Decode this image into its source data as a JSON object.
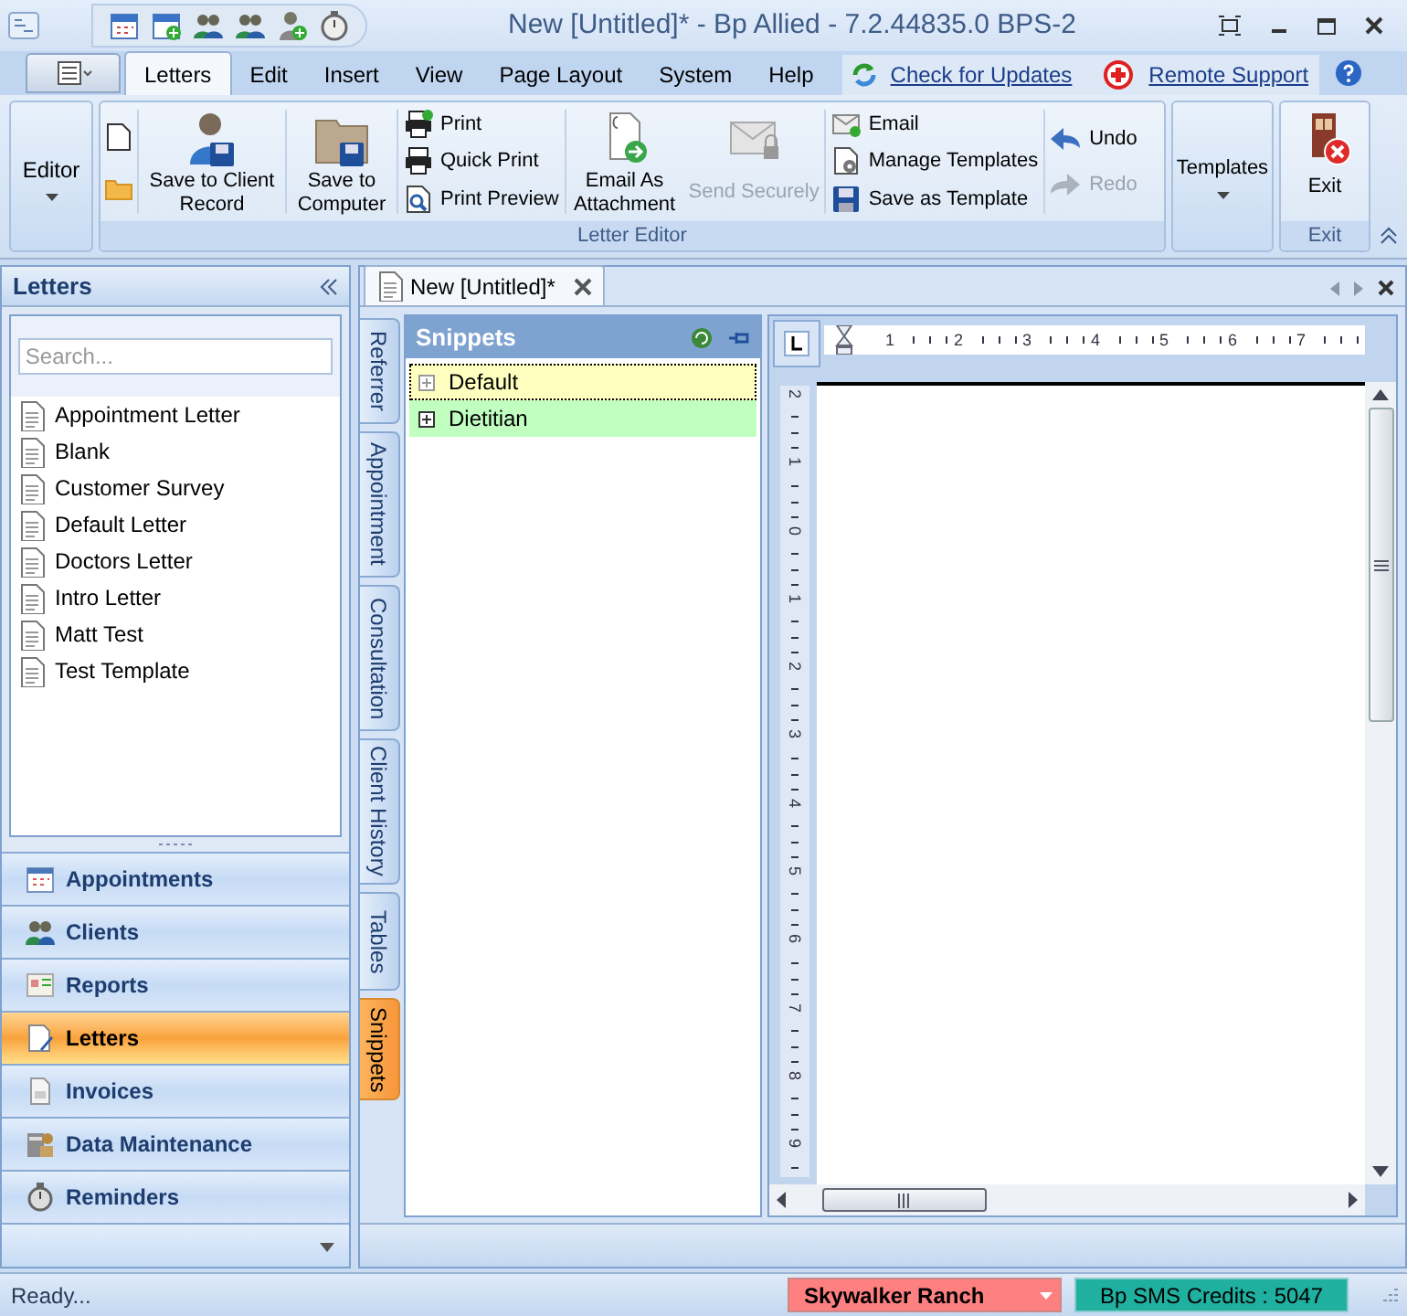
{
  "window": {
    "title": "New [Untitled]* - Bp Allied - 7.2.44835.0  BPS-2"
  },
  "menu_tabs": [
    {
      "label": "Letters",
      "selected": true
    },
    {
      "label": "Edit",
      "selected": false
    },
    {
      "label": "Insert",
      "selected": false
    },
    {
      "label": "View",
      "selected": false
    },
    {
      "label": "Page Layout",
      "selected": false
    },
    {
      "label": "System",
      "selected": false
    },
    {
      "label": "Help",
      "selected": false
    }
  ],
  "links": [
    "Check for Updates",
    "Remote Support"
  ],
  "ribbon": {
    "editor": "Editor",
    "letter_editor": {
      "label": "Letter Editor",
      "large": [
        {
          "label": "Save to Client Record",
          "disabled": false
        },
        {
          "label": "Save to Computer",
          "disabled": false
        }
      ],
      "print": [
        {
          "label": "Print",
          "disabled": false
        },
        {
          "label": "Quick Print",
          "disabled": false
        },
        {
          "label": "Print Preview",
          "disabled": false
        }
      ],
      "send": [
        {
          "label": "Email As Attachment",
          "disabled": false
        },
        {
          "label": "Send Securely",
          "disabled": true
        }
      ],
      "email": [
        {
          "label": "Email",
          "disabled": false
        },
        {
          "label": "Manage Templates",
          "disabled": false
        },
        {
          "label": "Save as Template",
          "disabled": false
        }
      ],
      "history": [
        {
          "label": "Undo",
          "disabled": false
        },
        {
          "label": "Redo",
          "disabled": true
        }
      ]
    },
    "templates": "Templates",
    "exit": {
      "button": "Exit",
      "group": "Exit"
    }
  },
  "left_panel": {
    "title": "Letters",
    "search": {
      "placeholder": "Search..."
    },
    "items": [
      "Appointment Letter",
      "Blank",
      "Customer Survey",
      "Default Letter",
      "Doctors Letter",
      "Intro Letter",
      "Matt Test",
      "Test Template"
    ]
  },
  "nav": [
    {
      "label": "Appointments",
      "selected": false
    },
    {
      "label": "Clients",
      "selected": false
    },
    {
      "label": "Reports",
      "selected": false
    },
    {
      "label": "Letters",
      "selected": true
    },
    {
      "label": "Invoices",
      "selected": false
    },
    {
      "label": "Data Maintenance",
      "selected": false
    },
    {
      "label": "Reminders",
      "selected": false
    }
  ],
  "document_tab": "New [Untitled]*",
  "side_tabs": [
    {
      "label": "Referrer",
      "selected": false
    },
    {
      "label": "Appointment",
      "selected": false
    },
    {
      "label": "Consultation",
      "selected": false
    },
    {
      "label": "Client History",
      "selected": false
    },
    {
      "label": "Tables",
      "selected": false
    },
    {
      "label": "Snippets",
      "selected": true
    }
  ],
  "snippets": {
    "title": "Snippets",
    "items": [
      {
        "label": "Default",
        "color": "#ffffc0",
        "selected": true
      },
      {
        "label": "Dietitian",
        "color": "#c0ffc0",
        "selected": false
      }
    ]
  },
  "ruler": {
    "horizontal": [
      "1",
      "2",
      "3",
      "4",
      "5",
      "6",
      "7"
    ],
    "vertical": [
      "2",
      "1",
      "0",
      "1",
      "2",
      "3",
      "4",
      "5",
      "6",
      "7",
      "8",
      "9"
    ]
  },
  "status_bar": {
    "text": "Ready...",
    "location": {
      "label": "Skywalker Ranch",
      "color": "#ff8080"
    },
    "credits": {
      "label": "Bp SMS Credits : 5047",
      "color": "#20b0a0"
    }
  }
}
